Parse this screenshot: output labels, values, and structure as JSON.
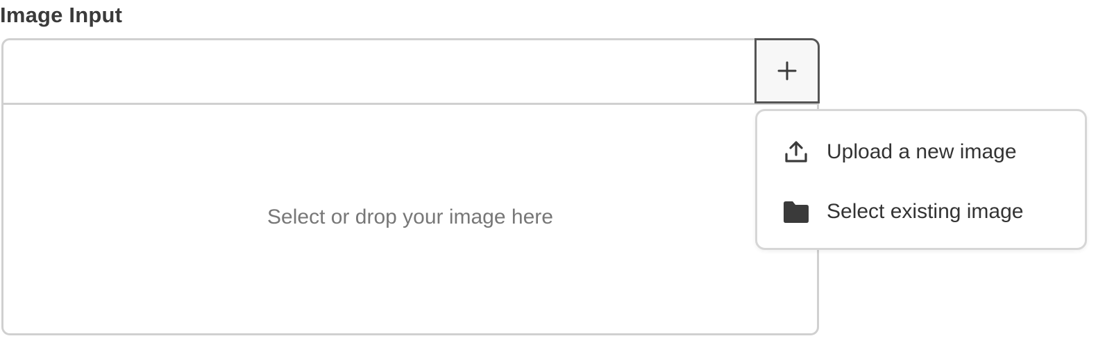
{
  "field": {
    "label": "Image Input"
  },
  "drop_zone": {
    "placeholder": "Select or drop your image here"
  },
  "add_button": {
    "icon": "plus-icon"
  },
  "menu": {
    "items": [
      {
        "label": "Upload a new image",
        "icon": "upload-icon"
      },
      {
        "label": "Select existing image",
        "icon": "folder-icon"
      }
    ]
  },
  "colors": {
    "border": "#d0d0d0",
    "active_border": "#555555",
    "text": "#333333",
    "placeholder_text": "#777777",
    "icon": "#3a3a3a"
  }
}
